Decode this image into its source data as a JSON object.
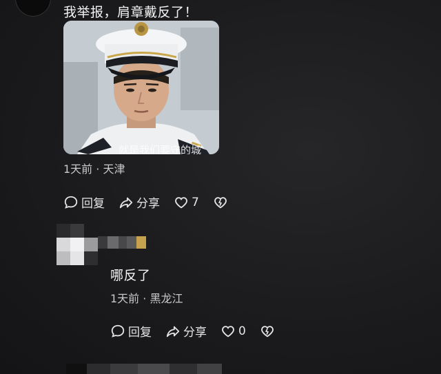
{
  "comment1": {
    "text": "我举报，肩章戴反了！",
    "image_caption": "就是我们要守的城",
    "meta_time": "1天前",
    "meta_sep": "·",
    "meta_location": "天津",
    "actions": {
      "reply_label": "回复",
      "share_label": "分享",
      "like_count": "7"
    }
  },
  "reply1": {
    "text": "哪反了",
    "meta_time": "1天前",
    "meta_sep": "·",
    "meta_location": "黑龙江",
    "actions": {
      "reply_label": "回复",
      "share_label": "分享",
      "like_count": "0"
    }
  },
  "icons": {
    "reply": "comment-bubble-icon",
    "share": "share-arrow-icon",
    "like": "heart-icon",
    "dislike": "broken-heart-icon"
  },
  "colors": {
    "background": "#1b1b1d",
    "text": "#f2f2f2",
    "meta": "#c9c9cc"
  }
}
